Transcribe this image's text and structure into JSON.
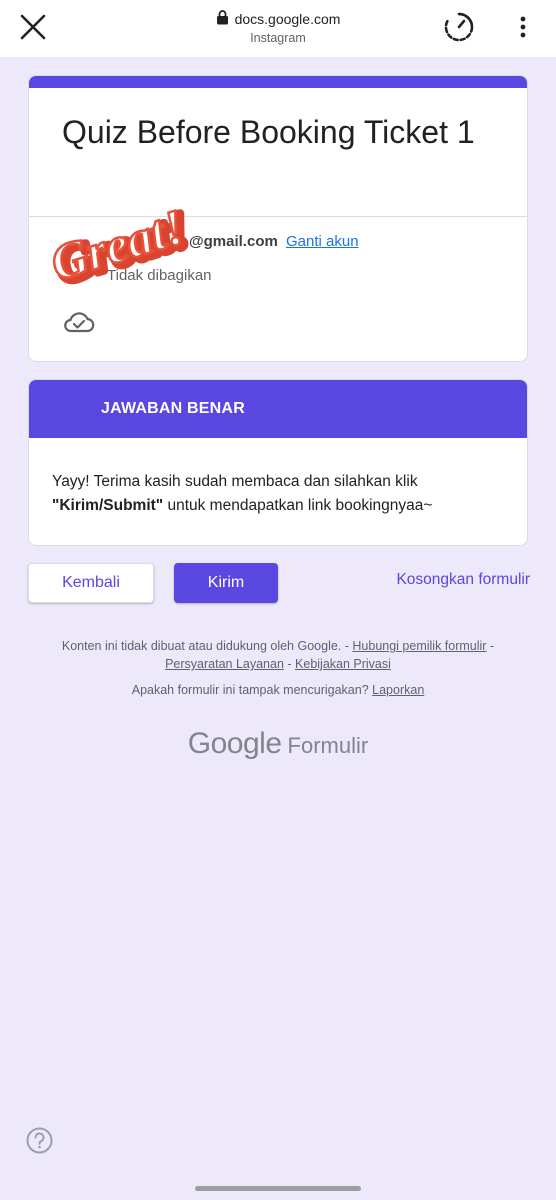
{
  "browser": {
    "url": "docs.google.com",
    "source": "Instagram",
    "close_icon": "close-icon",
    "lock_icon": "lock-icon",
    "timer_icon": "timer-icon",
    "more_icon": "more-vert-icon"
  },
  "form": {
    "title": "Quiz Before Booking Ticket 1",
    "account_email": "@gmail.com",
    "switch_account": "Ganti akun",
    "not_shared": "Tidak dibagikan",
    "accent_color": "#5a46e0"
  },
  "sticker": {
    "text": "Great!"
  },
  "result": {
    "heading": "JAWABAN BENAR",
    "message_part1": "Yayy! Terima kasih sudah membaca dan silahkan klik ",
    "message_bold": "\"Kirim/Submit\"",
    "message_part2": " untuk mendapatkan link bookingnyaa~"
  },
  "actions": {
    "back": "Kembali",
    "submit": "Kirim",
    "clear": "Kosongkan formulir"
  },
  "footer": {
    "disclaimer": "Konten ini tidak dibuat atau didukung oleh Google. - ",
    "contact_owner": "Hubungi pemilik formulir",
    "terms": "Persyaratan Layanan",
    "privacy": "Kebijakan Privasi",
    "sep": " - ",
    "suspicious": "Apakah formulir ini tampak mencurigakan? ",
    "report": "Laporkan",
    "brand_google": "Google",
    "brand_forms": "Formulir"
  }
}
